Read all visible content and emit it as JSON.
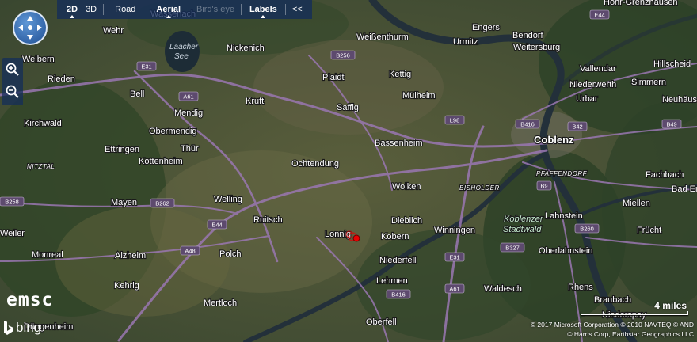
{
  "toolbar": {
    "items": [
      {
        "label": "2D",
        "active": true,
        "bold": true
      },
      {
        "label": "3D",
        "active": false,
        "bold": false
      },
      {
        "label": "Road",
        "active": false,
        "bold": false
      },
      {
        "label": "Aerial",
        "active": true,
        "bold": true
      },
      {
        "label": "Bird's eye",
        "active": false,
        "bold": false,
        "disabled": true
      },
      {
        "label": "Labels",
        "active": true,
        "bold": true
      },
      {
        "label": "<<",
        "active": false,
        "bold": false
      }
    ]
  },
  "controls": {
    "nav_icon": "pan-compass-icon",
    "zoom_in_icon": "zoom-in-icon",
    "zoom_out_icon": "zoom-out-icon"
  },
  "branding": {
    "emsc": "emsc",
    "bing": "bing"
  },
  "scale": {
    "label": "4 miles"
  },
  "credits": {
    "line1": "© 2017 Microsoft Corporation   © 2010 NAVTEQ   © AND",
    "line2": "© Harris Corp, Earthstar Geographics LLC"
  },
  "map": {
    "lake_label_1": "Laacher",
    "lake_label_2": "See",
    "places": [
      {
        "name": "Wehr"
      },
      {
        "name": "Wassenach"
      },
      {
        "name": "Nickenich"
      },
      {
        "name": "Weißenthurm"
      },
      {
        "name": "Urmitz"
      },
      {
        "name": "Engers"
      },
      {
        "name": "Bendorf"
      },
      {
        "name": "Weitersburg"
      },
      {
        "name": "Höhr-Grenzhausen"
      },
      {
        "name": "Weibern"
      },
      {
        "name": "Vallendar"
      },
      {
        "name": "Hillscheid"
      },
      {
        "name": "Rieden"
      },
      {
        "name": "Plaidt"
      },
      {
        "name": "Kettig"
      },
      {
        "name": "Niederwerth"
      },
      {
        "name": "Simmern"
      },
      {
        "name": "Bell"
      },
      {
        "name": "Kruft"
      },
      {
        "name": "Mülheim"
      },
      {
        "name": "Urbar"
      },
      {
        "name": "Neuhäusel"
      },
      {
        "name": "Saffig"
      },
      {
        "name": "Kirchwald"
      },
      {
        "name": "Mendig"
      },
      {
        "name": "Obermendig"
      },
      {
        "name": "Coblenz"
      },
      {
        "name": "Bassenheim"
      },
      {
        "name": "Ettringen"
      },
      {
        "name": "Thür"
      },
      {
        "name": "Kottenheim"
      },
      {
        "name": "Ochtendung"
      },
      {
        "name": "Fachbach"
      },
      {
        "name": "PFAFFENDORF"
      },
      {
        "name": "NITZTAL"
      },
      {
        "name": "BISHOLDER"
      },
      {
        "name": "Wolken"
      },
      {
        "name": "Bad Em"
      },
      {
        "name": "Welling"
      },
      {
        "name": "Mayen"
      },
      {
        "name": "Lahnstein"
      },
      {
        "name": "Miellen"
      },
      {
        "name": "Ruitsch"
      },
      {
        "name": "Dieblich"
      },
      {
        "name": "Koblenzer"
      },
      {
        "name": "Stadtwald"
      },
      {
        "name": "Weiler"
      },
      {
        "name": "Lonnig"
      },
      {
        "name": "Kobern"
      },
      {
        "name": "Winningen"
      },
      {
        "name": "Frücht"
      },
      {
        "name": "Monreal"
      },
      {
        "name": "Alzheim"
      },
      {
        "name": "Polch"
      },
      {
        "name": "Niederfell"
      },
      {
        "name": "Oberlahnstein"
      },
      {
        "name": "Lehmen"
      },
      {
        "name": "Waldesch"
      },
      {
        "name": "Kehrig"
      },
      {
        "name": "Rhens"
      },
      {
        "name": "Mertloch"
      },
      {
        "name": "Braubach"
      },
      {
        "name": "Niederspay"
      },
      {
        "name": "Düngenheim"
      },
      {
        "name": "Oberfell"
      }
    ],
    "roads": [
      {
        "name": "E44"
      },
      {
        "name": "E31"
      },
      {
        "name": "A61"
      },
      {
        "name": "B256"
      },
      {
        "name": "L98"
      },
      {
        "name": "B416"
      },
      {
        "name": "B42"
      },
      {
        "name": "B49"
      },
      {
        "name": "B9"
      },
      {
        "name": "B262"
      },
      {
        "name": "B258"
      },
      {
        "name": "E44"
      },
      {
        "name": "A48"
      },
      {
        "name": "B327"
      },
      {
        "name": "B260"
      },
      {
        "name": "E31"
      },
      {
        "name": "A61"
      },
      {
        "name": "B416"
      }
    ]
  },
  "epicenter": {
    "color": "#e60000"
  }
}
